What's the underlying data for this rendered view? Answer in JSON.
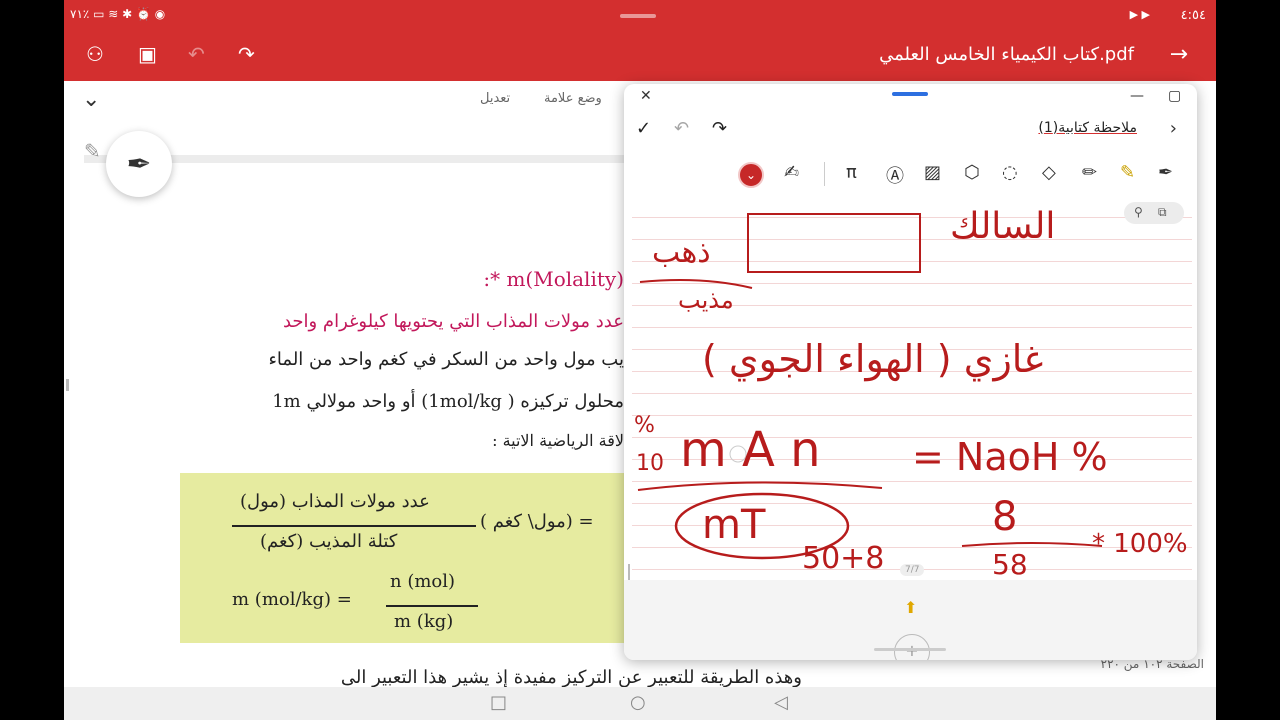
{
  "status": {
    "time": "٤:٥٤",
    "battery": "٧١٪",
    "icons": [
      "battery-icon",
      "wifi-icon",
      "bluetooth-icon",
      "alarm-icon",
      "nfc-icon",
      "eye-icon"
    ]
  },
  "app": {
    "title": "كتاب الكيمياء الخامس العلمي.pdf"
  },
  "toolbar": {
    "edit_label": "تعديل",
    "bookmark_label": "وضع علامة"
  },
  "doc": {
    "heading": "(Molality)m *:",
    "def_line": "عدد مولات المذاب التي يحتويها كيلوغرام واحد",
    "line2": "يب مول واحد من السكر في كغم واحد من الماء",
    "line3": "محلول تركيزه ( 1mol/kg) أو واحد مولالي 1m",
    "line4": "لاقة الرياضية الاتية :",
    "formula": {
      "frac1_num": "عدد مولات المذاب (مول)",
      "frac1_den": "كتلة المذيب (كغم)",
      "lhs1": "( مول\\ كغم) =",
      "lhs2": "m (mol/kg) =",
      "frac2_num": "n (mol)",
      "frac2_den": "m (kg)"
    },
    "bottom_line": "وهذه الطريقة للتعبير عن التركيز مفيدة إذ يشير هذا التعبير الى",
    "page_label": "الصفحة ١٠٢ من ٢٢٠"
  },
  "note": {
    "title": "ملاحظة كتابية(1)",
    "page_indicator": "7/7",
    "handwriting": {
      "w1": "السالك",
      "w2": "ذهب",
      "w3": "مذيب",
      "w4": "غازي ( الهواء الجوي )",
      "w5": "m A n",
      "w6": "%",
      "w7": "10",
      "w8": "= NaoH %",
      "w9": "mT",
      "w10": "8",
      "w11": "50+8",
      "w12": "58",
      "w13": "* 100%"
    }
  },
  "colors": {
    "brand": "#d32f2f",
    "heading": "#c2185b",
    "formula_bg": "#e6eba0",
    "ink": "#c62828"
  }
}
